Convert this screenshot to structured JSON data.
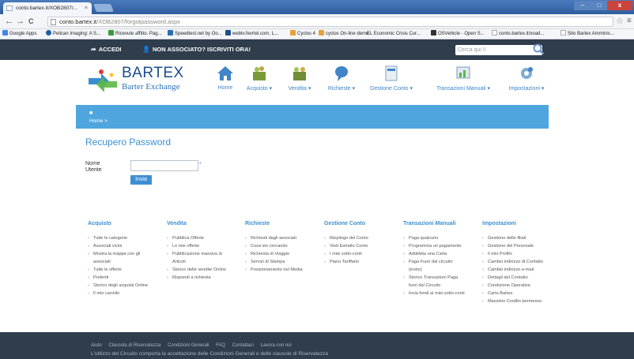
{
  "browser": {
    "tab_title": "conto.bartex.it/XOB2807/...",
    "tab_close": "×",
    "url_host": "conto.bartex.it",
    "url_path": "/XOB2807/forgotpassword.aspx",
    "star": "☆",
    "menu": "≡",
    "back": "←",
    "forward": "→",
    "reload": "C",
    "win_min": "–",
    "win_max": "□",
    "win_close": "x",
    "bookmarks": [
      {
        "label": "Google Apps",
        "color": "#4285f4"
      },
      {
        "label": "Pelican Imaging: A S...",
        "color": "#1a5fa8"
      },
      {
        "label": "Ricevute affitto. Pag...",
        "color": "#3a9a3a"
      },
      {
        "label": "Speedtest.net by Oo...",
        "color": "#2a6db0"
      },
      {
        "label": "webtv.fevrtel.com, L...",
        "color": "#1d4f8c"
      },
      {
        "label": "Cyclos 4",
        "color": "#e8a13a"
      },
      {
        "label": "cyclos On-line demo",
        "color": "#e8a13a"
      },
      {
        "label": "EL Economic Crisis Cur...",
        "color": "#999999"
      },
      {
        "label": "OSVehicle - Open S...",
        "color": "#333333"
      },
      {
        "label": "conto.bartex.it/xoad...",
        "color": "#cccccc"
      },
      {
        "label": "Sito Bartex Amminis...",
        "color": "#cccccc"
      }
    ]
  },
  "topbar": {
    "login": "ACCEDI",
    "register": "NON ASSOCIATO? ISCRIVITI ORA!",
    "search_placeholder": "Cerca qui !!"
  },
  "brand": {
    "name": "BARTEX",
    "tagline": "Barter Exchange"
  },
  "nav": [
    {
      "label": "Home"
    },
    {
      "label": "Acquisto ▾"
    },
    {
      "label": "Vendita ▾"
    },
    {
      "label": "Richieste ▾"
    },
    {
      "label": "Gestione Conto ▾"
    },
    {
      "label": "Transazioni Manuali ▾"
    },
    {
      "label": "Impostazioni ▾"
    }
  ],
  "breadcrumb": {
    "home": "Home  >"
  },
  "form": {
    "title": "Recupero Password",
    "label_line1": "Nome",
    "label_line2": "Utente",
    "input_value": "",
    "required_mark": "*",
    "submit": "Invia"
  },
  "sitemap": [
    {
      "title": "Acquisto",
      "items": [
        "Tutte le categorie",
        "Associati vicini",
        "Mostra la mappa con gli",
        "associati",
        "Tutte le offerte",
        "Preferiti",
        "Storico degli acquisti Online",
        "Il mio carrello"
      ]
    },
    {
      "title": "Vendita",
      "items": [
        "Pubblica Offerte",
        "Le mie offerte",
        "Pubblicazione massiva di",
        "Articoli",
        "Storico delle vendite Online",
        "Rispondi a richieste"
      ]
    },
    {
      "title": "Richieste",
      "items": [
        "Richiesti dagli associati",
        "Cosa sto cercando",
        "Richiesta di Viaggio",
        "Servizi di Stampa",
        "Posizionamento nel Media"
      ]
    },
    {
      "title": "Gestione Conto",
      "items": [
        "Riepilogo del Conto",
        "Vedi Estratto Conto",
        "I miei sotto-conti",
        "Piano Tariffario"
      ]
    },
    {
      "title": "Transazioni Manuali",
      "items": [
        "Paga qualcuno",
        "Programma un pagamento",
        "Addebita una Carta",
        "Paga Fuori dal circuito",
        "(invito)",
        "Storico Transazioni Paga",
        "fuori dal Circuito",
        "Invia fondi ai miei sotto-conti"
      ]
    },
    {
      "title": "Impostazioni",
      "items": [
        "Gestione delle filiali",
        "Gestione del Personale",
        "Il mio Profilo",
        "Cambio indirizzo di Contatto",
        "Cambio indirizzo e-mail",
        "Dettagli del Contatto",
        "Condizione Operativa",
        "Carta Bartex",
        "Massimo Credito permesso"
      ]
    }
  ],
  "footer": {
    "links": [
      "Aiuto",
      "Clausola di Riservatezza",
      "Condizioni Generali",
      "FAQ",
      "Contattaci",
      "Lavora con noi"
    ],
    "note": "L'utilizzo del Circuito comporta la accettazione delle Condizioni Generali e delle clausole di Riservatezza"
  }
}
